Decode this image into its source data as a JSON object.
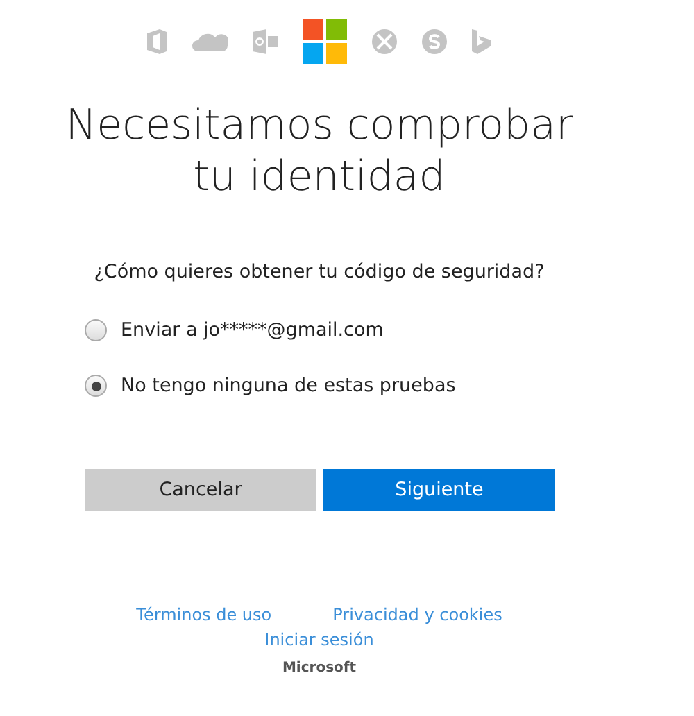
{
  "title_lines": [
    "Necesitamos comprobar",
    "tu identidad"
  ],
  "question": "¿Cómo quieres obtener tu código de seguridad?",
  "options": [
    {
      "label": "Enviar a jo*****@gmail.com",
      "selected": false
    },
    {
      "label": "No tengo ninguna de estas pruebas",
      "selected": true
    }
  ],
  "buttons": [
    {
      "label": "Cancelar",
      "kind": "secondary"
    },
    {
      "label": "Siguiente",
      "kind": "primary"
    }
  ],
  "footer_links": [
    "Términos de uso",
    "Privacidad y cookies"
  ],
  "sign_in_link": "Iniciar sesión",
  "brand": "Microsoft"
}
